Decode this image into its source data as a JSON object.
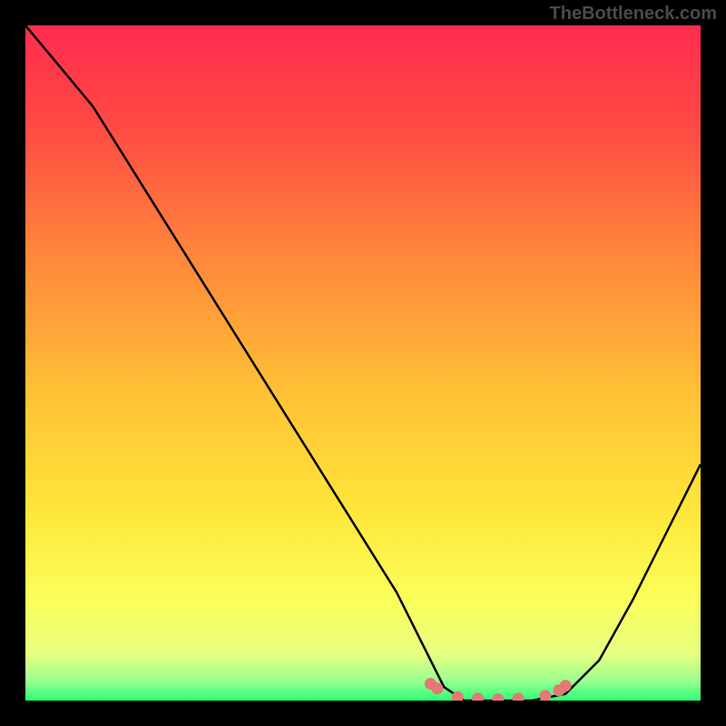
{
  "watermark": "TheBottleneck.com",
  "chart_data": {
    "type": "line",
    "title": "",
    "xlabel": "",
    "ylabel": "",
    "xlim": [
      0,
      100
    ],
    "ylim": [
      0,
      100
    ],
    "grid": false,
    "series": [
      {
        "name": "bottleneck-curve",
        "color": "#000000",
        "x": [
          0,
          5,
          10,
          15,
          20,
          25,
          30,
          35,
          40,
          45,
          50,
          55,
          60,
          62,
          65,
          70,
          75,
          80,
          85,
          90,
          95,
          100
        ],
        "y": [
          100,
          94,
          88,
          80,
          72,
          64,
          56,
          48,
          40,
          32,
          24,
          16,
          6,
          2,
          0,
          0,
          0,
          1,
          6,
          15,
          25,
          35
        ]
      }
    ],
    "highlight": {
      "color": "#e57777",
      "x": [
        60,
        61,
        64,
        67,
        70,
        73,
        77,
        79,
        80
      ],
      "y": [
        2.5,
        1.8,
        0.5,
        0.3,
        0.2,
        0.3,
        0.7,
        1.5,
        2.2
      ]
    },
    "background_gradient": {
      "stops": [
        {
          "offset": 0,
          "color": "#ff2b4f"
        },
        {
          "offset": 0.15,
          "color": "#ff4a44"
        },
        {
          "offset": 0.35,
          "color": "#ff8a3a"
        },
        {
          "offset": 0.55,
          "color": "#ffc236"
        },
        {
          "offset": 0.72,
          "color": "#ffe63a"
        },
        {
          "offset": 0.85,
          "color": "#fbff5a"
        },
        {
          "offset": 0.93,
          "color": "#e8ff80"
        },
        {
          "offset": 0.97,
          "color": "#9cff90"
        },
        {
          "offset": 1.0,
          "color": "#2bff78"
        }
      ]
    }
  }
}
